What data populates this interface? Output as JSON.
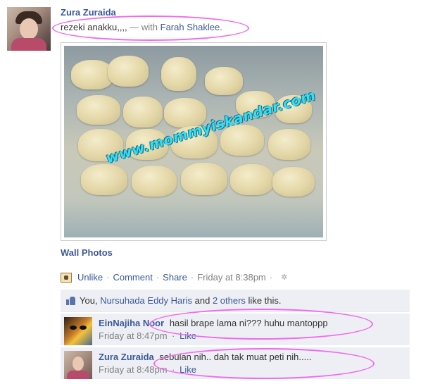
{
  "post": {
    "author": "Zura Zuraida",
    "status_text": "rezeki anakku,,,,",
    "separator": "— with",
    "tagged": "Farah Shaklee.",
    "photo_watermark": "www.mommyiskandar.com",
    "album": "Wall Photos"
  },
  "actions": {
    "unlike": "Unlike",
    "comment": "Comment",
    "share": "Share",
    "timestamp": "Friday at 8:38pm",
    "dot": "·"
  },
  "likes": {
    "prefix": "You,",
    "liker": "Nursuhada Eddy Haris",
    "and": "and",
    "others": "2 others",
    "suffix": "like this."
  },
  "comments": [
    {
      "author": "EinNajiha Noor",
      "text": "hasil brape lama ni??? huhu mantoppp",
      "timestamp": "Friday at 8:47pm",
      "like": "Like"
    },
    {
      "author": "Zura Zuraida",
      "text": "sebulan nih.. dah tak muat peti nih.....",
      "timestamp": "Friday at 8:48pm",
      "like": "Like"
    }
  ],
  "icons": {
    "post_type": "photo-post-icon",
    "settings": "settings-icon",
    "like": "thumbs-up-icon"
  },
  "colors": {
    "link": "#3b5998",
    "muted": "#808080",
    "ufi_background": "#edeff4",
    "annotation": "#f06af0",
    "watermark": "#33e0f0"
  }
}
